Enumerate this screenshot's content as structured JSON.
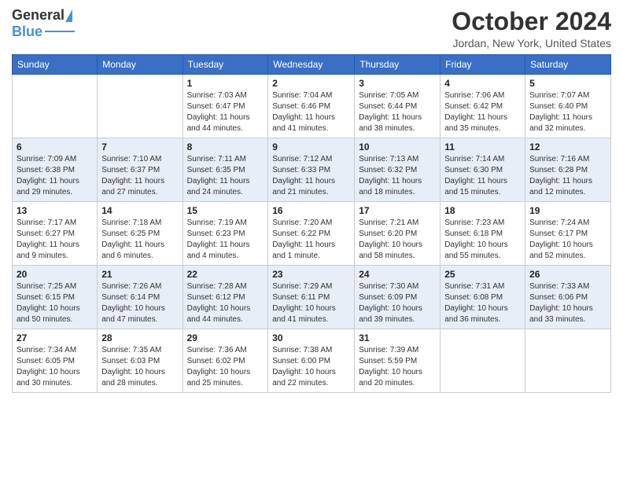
{
  "header": {
    "logo_general": "General",
    "logo_blue": "Blue",
    "month_title": "October 2024",
    "subtitle": "Jordan, New York, United States"
  },
  "days_of_week": [
    "Sunday",
    "Monday",
    "Tuesday",
    "Wednesday",
    "Thursday",
    "Friday",
    "Saturday"
  ],
  "weeks": [
    [
      {
        "day": null,
        "info": null
      },
      {
        "day": null,
        "info": null
      },
      {
        "day": "1",
        "sunrise": "Sunrise: 7:03 AM",
        "sunset": "Sunset: 6:47 PM",
        "daylight": "Daylight: 11 hours and 44 minutes."
      },
      {
        "day": "2",
        "sunrise": "Sunrise: 7:04 AM",
        "sunset": "Sunset: 6:46 PM",
        "daylight": "Daylight: 11 hours and 41 minutes."
      },
      {
        "day": "3",
        "sunrise": "Sunrise: 7:05 AM",
        "sunset": "Sunset: 6:44 PM",
        "daylight": "Daylight: 11 hours and 38 minutes."
      },
      {
        "day": "4",
        "sunrise": "Sunrise: 7:06 AM",
        "sunset": "Sunset: 6:42 PM",
        "daylight": "Daylight: 11 hours and 35 minutes."
      },
      {
        "day": "5",
        "sunrise": "Sunrise: 7:07 AM",
        "sunset": "Sunset: 6:40 PM",
        "daylight": "Daylight: 11 hours and 32 minutes."
      }
    ],
    [
      {
        "day": "6",
        "sunrise": "Sunrise: 7:09 AM",
        "sunset": "Sunset: 6:38 PM",
        "daylight": "Daylight: 11 hours and 29 minutes."
      },
      {
        "day": "7",
        "sunrise": "Sunrise: 7:10 AM",
        "sunset": "Sunset: 6:37 PM",
        "daylight": "Daylight: 11 hours and 27 minutes."
      },
      {
        "day": "8",
        "sunrise": "Sunrise: 7:11 AM",
        "sunset": "Sunset: 6:35 PM",
        "daylight": "Daylight: 11 hours and 24 minutes."
      },
      {
        "day": "9",
        "sunrise": "Sunrise: 7:12 AM",
        "sunset": "Sunset: 6:33 PM",
        "daylight": "Daylight: 11 hours and 21 minutes."
      },
      {
        "day": "10",
        "sunrise": "Sunrise: 7:13 AM",
        "sunset": "Sunset: 6:32 PM",
        "daylight": "Daylight: 11 hours and 18 minutes."
      },
      {
        "day": "11",
        "sunrise": "Sunrise: 7:14 AM",
        "sunset": "Sunset: 6:30 PM",
        "daylight": "Daylight: 11 hours and 15 minutes."
      },
      {
        "day": "12",
        "sunrise": "Sunrise: 7:16 AM",
        "sunset": "Sunset: 6:28 PM",
        "daylight": "Daylight: 11 hours and 12 minutes."
      }
    ],
    [
      {
        "day": "13",
        "sunrise": "Sunrise: 7:17 AM",
        "sunset": "Sunset: 6:27 PM",
        "daylight": "Daylight: 11 hours and 9 minutes."
      },
      {
        "day": "14",
        "sunrise": "Sunrise: 7:18 AM",
        "sunset": "Sunset: 6:25 PM",
        "daylight": "Daylight: 11 hours and 6 minutes."
      },
      {
        "day": "15",
        "sunrise": "Sunrise: 7:19 AM",
        "sunset": "Sunset: 6:23 PM",
        "daylight": "Daylight: 11 hours and 4 minutes."
      },
      {
        "day": "16",
        "sunrise": "Sunrise: 7:20 AM",
        "sunset": "Sunset: 6:22 PM",
        "daylight": "Daylight: 11 hours and 1 minute."
      },
      {
        "day": "17",
        "sunrise": "Sunrise: 7:21 AM",
        "sunset": "Sunset: 6:20 PM",
        "daylight": "Daylight: 10 hours and 58 minutes."
      },
      {
        "day": "18",
        "sunrise": "Sunrise: 7:23 AM",
        "sunset": "Sunset: 6:18 PM",
        "daylight": "Daylight: 10 hours and 55 minutes."
      },
      {
        "day": "19",
        "sunrise": "Sunrise: 7:24 AM",
        "sunset": "Sunset: 6:17 PM",
        "daylight": "Daylight: 10 hours and 52 minutes."
      }
    ],
    [
      {
        "day": "20",
        "sunrise": "Sunrise: 7:25 AM",
        "sunset": "Sunset: 6:15 PM",
        "daylight": "Daylight: 10 hours and 50 minutes."
      },
      {
        "day": "21",
        "sunrise": "Sunrise: 7:26 AM",
        "sunset": "Sunset: 6:14 PM",
        "daylight": "Daylight: 10 hours and 47 minutes."
      },
      {
        "day": "22",
        "sunrise": "Sunrise: 7:28 AM",
        "sunset": "Sunset: 6:12 PM",
        "daylight": "Daylight: 10 hours and 44 minutes."
      },
      {
        "day": "23",
        "sunrise": "Sunrise: 7:29 AM",
        "sunset": "Sunset: 6:11 PM",
        "daylight": "Daylight: 10 hours and 41 minutes."
      },
      {
        "day": "24",
        "sunrise": "Sunrise: 7:30 AM",
        "sunset": "Sunset: 6:09 PM",
        "daylight": "Daylight: 10 hours and 39 minutes."
      },
      {
        "day": "25",
        "sunrise": "Sunrise: 7:31 AM",
        "sunset": "Sunset: 6:08 PM",
        "daylight": "Daylight: 10 hours and 36 minutes."
      },
      {
        "day": "26",
        "sunrise": "Sunrise: 7:33 AM",
        "sunset": "Sunset: 6:06 PM",
        "daylight": "Daylight: 10 hours and 33 minutes."
      }
    ],
    [
      {
        "day": "27",
        "sunrise": "Sunrise: 7:34 AM",
        "sunset": "Sunset: 6:05 PM",
        "daylight": "Daylight: 10 hours and 30 minutes."
      },
      {
        "day": "28",
        "sunrise": "Sunrise: 7:35 AM",
        "sunset": "Sunset: 6:03 PM",
        "daylight": "Daylight: 10 hours and 28 minutes."
      },
      {
        "day": "29",
        "sunrise": "Sunrise: 7:36 AM",
        "sunset": "Sunset: 6:02 PM",
        "daylight": "Daylight: 10 hours and 25 minutes."
      },
      {
        "day": "30",
        "sunrise": "Sunrise: 7:38 AM",
        "sunset": "Sunset: 6:00 PM",
        "daylight": "Daylight: 10 hours and 22 minutes."
      },
      {
        "day": "31",
        "sunrise": "Sunrise: 7:39 AM",
        "sunset": "Sunset: 5:59 PM",
        "daylight": "Daylight: 10 hours and 20 minutes."
      },
      {
        "day": null,
        "info": null
      },
      {
        "day": null,
        "info": null
      }
    ]
  ]
}
